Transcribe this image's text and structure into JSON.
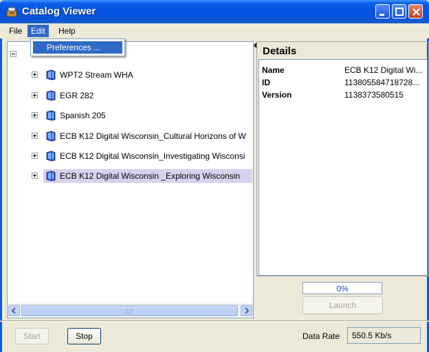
{
  "window": {
    "title": "Catalog Viewer"
  },
  "menu": {
    "file": "File",
    "edit": "Edit",
    "help": "Help",
    "edit_items": [
      "Preferences ..."
    ]
  },
  "tree": {
    "rows": [
      {
        "label": "WPT2 Stream WHA",
        "selected": false
      },
      {
        "label": "EGR 282",
        "selected": false
      },
      {
        "label": "Spanish 205",
        "selected": false
      },
      {
        "label": "ECB K12 Digital Wisconsin_Cultural Horizons of W",
        "selected": false
      },
      {
        "label": "ECB K12 Digital Wisconsin_Investigating Wisconsi",
        "selected": false
      },
      {
        "label": "ECB K12 Digital Wisconsin _Exploring  Wisconsin",
        "selected": true
      }
    ]
  },
  "details": {
    "title": "Details",
    "fields": [
      {
        "key": "Name",
        "value": "ECB K12 Digital Wi..."
      },
      {
        "key": "ID",
        "value": "113805584718728..."
      },
      {
        "key": "Version",
        "value": "1138373580515"
      }
    ]
  },
  "progress": {
    "percent_label": "0%",
    "percent": 0
  },
  "buttons": {
    "launch": "Launch",
    "start": "Start",
    "stop": "Stop"
  },
  "status": {
    "rate_label": "Data Rate",
    "rate_value": "550.5 Kb/s"
  },
  "colors": {
    "titlebar": "#0353e0",
    "menu_highlight": "#316ac5",
    "selection": "#d6d3f0"
  },
  "icons": {
    "app": "catalog-app-icon",
    "row": "book-icon"
  }
}
